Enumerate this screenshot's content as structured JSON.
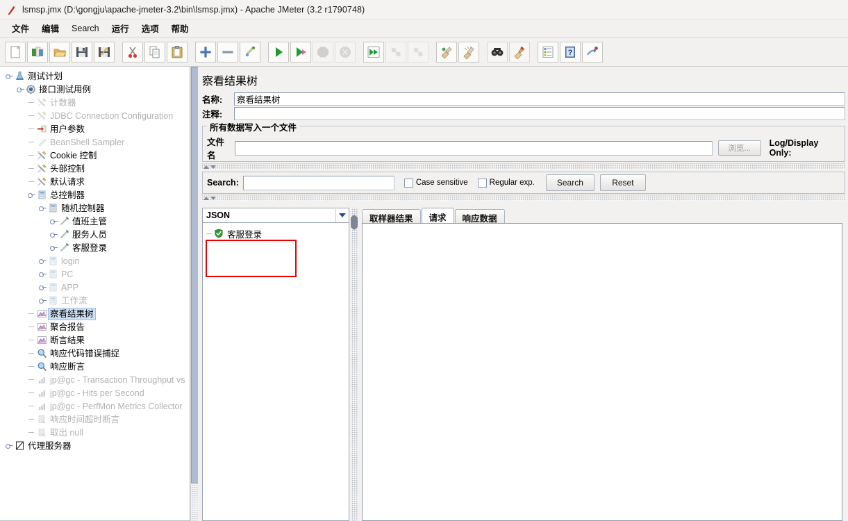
{
  "window": {
    "title": "lsmsp.jmx (D:\\gongju\\apache-jmeter-3.2\\bin\\lsmsp.jmx) - Apache JMeter (3.2 r1790748)",
    "icon": "jmeter-feather-icon"
  },
  "menubar": {
    "items": [
      {
        "label": "文件",
        "name": "menu-file"
      },
      {
        "label": "编辑",
        "name": "menu-edit"
      },
      {
        "label": "Search",
        "name": "menu-search"
      },
      {
        "label": "运行",
        "name": "menu-run"
      },
      {
        "label": "选项",
        "name": "menu-options"
      },
      {
        "label": "帮助",
        "name": "menu-help"
      }
    ]
  },
  "toolbar": {
    "buttons": [
      {
        "icon": "new-document-icon",
        "name": "toolbar-new",
        "disabled": false
      },
      {
        "icon": "templates-icon",
        "name": "toolbar-templates",
        "disabled": false
      },
      {
        "icon": "open-folder-icon",
        "name": "toolbar-open",
        "disabled": false
      },
      {
        "icon": "save-floppy-icon",
        "name": "toolbar-save",
        "disabled": false
      },
      {
        "icon": "save-as-icon",
        "name": "toolbar-save-as",
        "disabled": false
      },
      {
        "icon": "scissors-cut-icon",
        "name": "toolbar-cut",
        "disabled": false
      },
      {
        "icon": "copy-pages-icon",
        "name": "toolbar-copy",
        "disabled": false
      },
      {
        "icon": "clipboard-paste-icon",
        "name": "toolbar-paste",
        "disabled": false
      },
      {
        "icon": "plus-expand-icon",
        "name": "toolbar-expand-all",
        "disabled": false
      },
      {
        "icon": "minus-collapse-icon",
        "name": "toolbar-collapse-all",
        "disabled": false
      },
      {
        "icon": "toggle-broom-icon",
        "name": "toolbar-toggle",
        "disabled": false
      },
      {
        "icon": "green-play-icon",
        "name": "toolbar-start",
        "disabled": false
      },
      {
        "icon": "green-play-norecord-icon",
        "name": "toolbar-start-no-pauses",
        "disabled": false
      },
      {
        "icon": "stop-icon",
        "name": "toolbar-stop",
        "disabled": true
      },
      {
        "icon": "shutdown-icon",
        "name": "toolbar-shutdown",
        "disabled": true
      },
      {
        "icon": "remote-start-icon",
        "name": "toolbar-remote-start-all",
        "disabled": false
      },
      {
        "icon": "remote-stop-icon",
        "name": "toolbar-remote-stop-all",
        "disabled": true
      },
      {
        "icon": "remote-shutdown-icon",
        "name": "toolbar-remote-shutdown-all",
        "disabled": true
      },
      {
        "icon": "clear-icon",
        "name": "toolbar-clear",
        "disabled": false
      },
      {
        "icon": "clear-all-icon",
        "name": "toolbar-clear-all",
        "disabled": false
      },
      {
        "icon": "binoculars-search-icon",
        "name": "toolbar-search",
        "disabled": false
      },
      {
        "icon": "broom-reset-search-icon",
        "name": "toolbar-reset-search",
        "disabled": false
      },
      {
        "icon": "function-helper-icon",
        "name": "toolbar-function-helper",
        "disabled": false
      },
      {
        "icon": "help-book-icon",
        "name": "toolbar-help",
        "disabled": false
      },
      {
        "icon": "undo-arrow-icon",
        "name": "toolbar-undo",
        "disabled": false
      }
    ]
  },
  "tree": {
    "nodes": [
      {
        "label": "测试计划",
        "depth": 0,
        "icon": "test-plan-icon",
        "toggle": true,
        "dim": false,
        "selected": false
      },
      {
        "label": "接口测试用例",
        "depth": 1,
        "icon": "thread-group-icon",
        "toggle": true,
        "dim": false,
        "selected": false
      },
      {
        "label": "计数器",
        "depth": 2,
        "icon": "config-wrench-icon",
        "toggle": false,
        "dim": true,
        "selected": false
      },
      {
        "label": "JDBC Connection Configuration",
        "depth": 2,
        "icon": "config-wrench-icon",
        "toggle": false,
        "dim": true,
        "selected": false
      },
      {
        "label": "用户参数",
        "depth": 2,
        "icon": "preprocessor-icon",
        "toggle": false,
        "dim": false,
        "selected": false
      },
      {
        "label": "BeanShell Sampler",
        "depth": 2,
        "icon": "beanshell-icon",
        "toggle": false,
        "dim": true,
        "selected": false
      },
      {
        "label": "Cookie 控制",
        "depth": 2,
        "icon": "config-wrench-icon",
        "toggle": false,
        "dim": false,
        "selected": false
      },
      {
        "label": "头部控制",
        "depth": 2,
        "icon": "config-wrench-icon",
        "toggle": false,
        "dim": false,
        "selected": false
      },
      {
        "label": "默认请求",
        "depth": 2,
        "icon": "config-wrench-icon",
        "toggle": false,
        "dim": false,
        "selected": false
      },
      {
        "label": "总控制器",
        "depth": 2,
        "icon": "controller-icon",
        "toggle": true,
        "dim": false,
        "selected": false
      },
      {
        "label": "随机控制器",
        "depth": 3,
        "icon": "controller-icon",
        "toggle": true,
        "dim": false,
        "selected": false
      },
      {
        "label": "值班主管",
        "depth": 4,
        "icon": "sampler-pen-icon",
        "toggle": true,
        "dim": false,
        "selected": false
      },
      {
        "label": "服务人员",
        "depth": 4,
        "icon": "sampler-pen-icon",
        "toggle": true,
        "dim": false,
        "selected": false
      },
      {
        "label": "客服登录",
        "depth": 4,
        "icon": "sampler-pen-icon",
        "toggle": true,
        "dim": false,
        "selected": false
      },
      {
        "label": "login",
        "depth": 3,
        "icon": "controller-icon",
        "toggle": true,
        "dim": true,
        "selected": false
      },
      {
        "label": "PC",
        "depth": 3,
        "icon": "controller-icon",
        "toggle": true,
        "dim": true,
        "selected": false
      },
      {
        "label": "APP",
        "depth": 3,
        "icon": "controller-icon",
        "toggle": true,
        "dim": true,
        "selected": false
      },
      {
        "label": "工作流",
        "depth": 3,
        "icon": "controller-icon",
        "toggle": true,
        "dim": true,
        "selected": false
      },
      {
        "label": "察看结果树",
        "depth": 2,
        "icon": "listener-graph-icon",
        "toggle": false,
        "dim": false,
        "selected": true
      },
      {
        "label": "聚合报告",
        "depth": 2,
        "icon": "listener-graph-icon",
        "toggle": false,
        "dim": false,
        "selected": false
      },
      {
        "label": "断言结果",
        "depth": 2,
        "icon": "listener-graph-icon",
        "toggle": false,
        "dim": false,
        "selected": false
      },
      {
        "label": "响应代码错误捕捉",
        "depth": 2,
        "icon": "magnifier-icon",
        "toggle": false,
        "dim": false,
        "selected": false
      },
      {
        "label": "响应断言",
        "depth": 2,
        "icon": "magnifier-icon",
        "toggle": false,
        "dim": false,
        "selected": false
      },
      {
        "label": "jp@gc - Transaction Throughput vs",
        "depth": 2,
        "icon": "bar-chart-icon",
        "toggle": false,
        "dim": true,
        "selected": false
      },
      {
        "label": "jp@gc - Hits per Second",
        "depth": 2,
        "icon": "bar-chart-icon",
        "toggle": false,
        "dim": true,
        "selected": false
      },
      {
        "label": "jp@gc - PerfMon Metrics Collector",
        "depth": 2,
        "icon": "bar-chart-icon",
        "toggle": false,
        "dim": true,
        "selected": false
      },
      {
        "label": "响应时间超时断言",
        "depth": 2,
        "icon": "assertion-icon",
        "toggle": false,
        "dim": true,
        "selected": false
      },
      {
        "label": "取出 null",
        "depth": 2,
        "icon": "assertion-icon",
        "toggle": false,
        "dim": true,
        "selected": false
      },
      {
        "label": "代理服务器",
        "depth": 0,
        "icon": "proxy-server-icon",
        "toggle": true,
        "dim": false,
        "selected": false
      }
    ]
  },
  "panel": {
    "title": "察看结果树",
    "name_label": "名称:",
    "name_value": "察看结果树",
    "comment_label": "注释:",
    "comment_value": "",
    "file_group_title": "所有数据写入一个文件",
    "filename_label": "文件名",
    "filename_value": "",
    "browse_label": "浏览...",
    "log_display_label": "Log/Display Only:"
  },
  "search": {
    "label": "Search:",
    "value": "",
    "case_sensitive_label": "Case sensitive",
    "case_sensitive_checked": false,
    "regular_exp_label": "Regular exp.",
    "regular_exp_checked": false,
    "search_button": "Search",
    "reset_button": "Reset"
  },
  "results": {
    "renderer_selected": "JSON",
    "renderer_options": [
      "JSON"
    ],
    "entries": [
      {
        "label": "客服登录",
        "icon": "green-shield-success-icon",
        "highlighted": true
      }
    ],
    "tabs": [
      {
        "label": "取样器结果",
        "name": "tab-sampler-result",
        "active": false
      },
      {
        "label": "请求",
        "name": "tab-request",
        "active": true
      },
      {
        "label": "响应数据",
        "name": "tab-response-data",
        "active": false
      }
    ],
    "tab_content_text": ""
  },
  "colors": {
    "selection_blue": "#cfe0f4",
    "highlight_red": "#ee0000",
    "panel_bg": "#f2f1ef",
    "success_green": "#2e9b30"
  }
}
